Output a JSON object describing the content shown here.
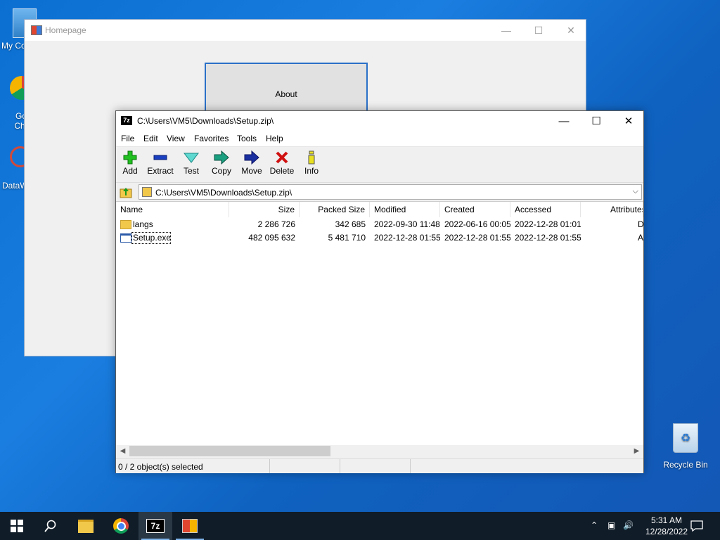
{
  "desktop": {
    "icons": [
      {
        "label": "My Co"
      },
      {
        "label": "Go Chr"
      },
      {
        "label": "DataW"
      },
      {
        "label": "Recycle Bin"
      }
    ]
  },
  "homepage_window": {
    "title": "Homepage",
    "about_label": "About"
  },
  "zip_window": {
    "title": "C:\\Users\\VM5\\Downloads\\Setup.zip\\",
    "logo": "7z",
    "menu": [
      "File",
      "Edit",
      "View",
      "Favorites",
      "Tools",
      "Help"
    ],
    "toolbar": [
      "Add",
      "Extract",
      "Test",
      "Copy",
      "Move",
      "Delete",
      "Info"
    ],
    "address": "C:\\Users\\VM5\\Downloads\\Setup.zip\\",
    "columns": [
      "Name",
      "Size",
      "Packed Size",
      "Modified",
      "Created",
      "Accessed",
      "Attributes"
    ],
    "rows": [
      {
        "name": "langs",
        "size": "2 286 726",
        "packed": "342 685",
        "modified": "2022-09-30 11:48",
        "created": "2022-06-16 00:05",
        "accessed": "2022-12-28 01:01",
        "attr": "D"
      },
      {
        "name": "Setup.exe",
        "size": "482 095 632",
        "packed": "5 481 710",
        "modified": "2022-12-28 01:55",
        "created": "2022-12-28 01:55",
        "accessed": "2022-12-28 01:55",
        "attr": "A"
      }
    ],
    "status": "0 / 2 object(s) selected"
  },
  "taskbar": {
    "time": "5:31 AM",
    "date": "12/28/2022",
    "zip_label": "7z"
  },
  "colors": {
    "accent": "#2a70c8",
    "taskbar": "#101c28"
  }
}
